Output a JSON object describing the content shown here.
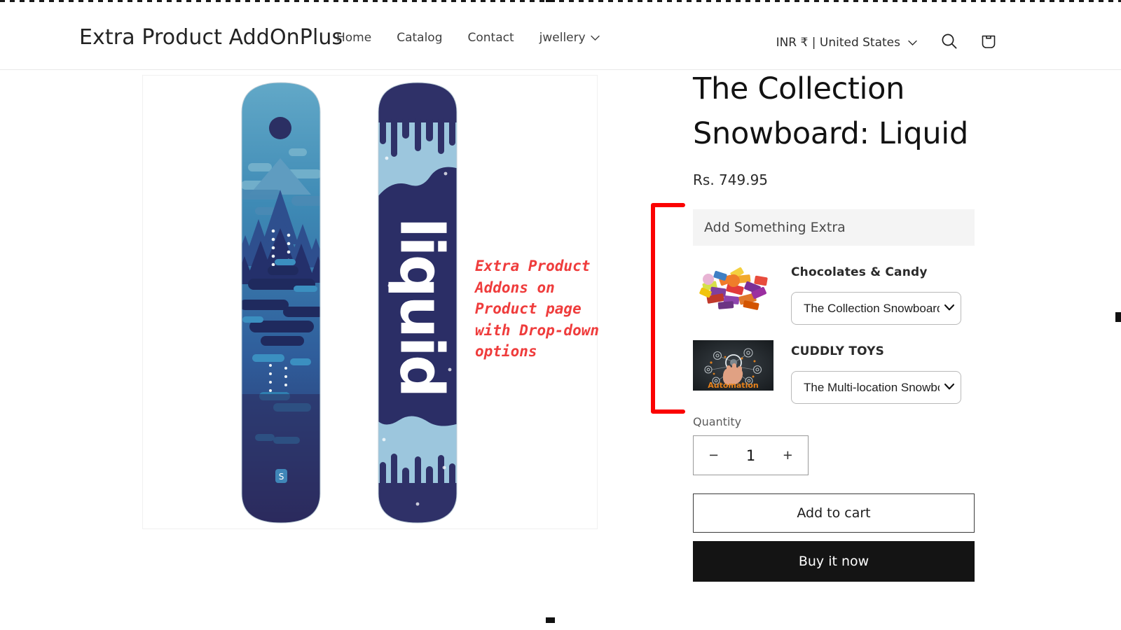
{
  "header": {
    "brand": "Extra Product AddOnPlus",
    "nav": [
      {
        "label": "Home",
        "has_caret": false
      },
      {
        "label": "Catalog",
        "has_caret": false
      },
      {
        "label": "Contact",
        "has_caret": false
      },
      {
        "label": "jwellery",
        "has_caret": true
      }
    ],
    "locale": "INR ₹ | United States",
    "search_icon": "search-icon",
    "cart_icon": "cart-icon"
  },
  "annotation": {
    "text": "Extra Product\nAddons on\nProduct page\nwith Drop-down\noptions",
    "color": "#ef3c3c"
  },
  "product": {
    "title": "The Collection Snowboard: Liquid",
    "price": "Rs. 749.95",
    "addon_section_title": "Add Something Extra",
    "addons": [
      {
        "name": "Chocolates & Candy",
        "thumb": "chocolates-candy-thumbnail",
        "selected_option": "The Collection Snowboard:",
        "options": [
          "The Collection Snowboard:"
        ]
      },
      {
        "name": "CUDDLY TOYS",
        "thumb": "automation-thumbnail",
        "thumb_caption": "Automation",
        "selected_option": "The Multi-location Snowboa",
        "options": [
          "The Multi-location Snowboa"
        ]
      }
    ],
    "quantity_label": "Quantity",
    "quantity_value": "1",
    "quantity_minus": "−",
    "quantity_plus": "+",
    "add_to_cart_label": "Add to cart",
    "buy_now_label": "Buy it now"
  },
  "gallery": {
    "alt": "The Collection Snowboard: Liquid — two snowboards, forest night graphic and liquid logo graphic",
    "board_logo_text": "liquid",
    "shopify_mark": "shopify-bag-icon"
  }
}
